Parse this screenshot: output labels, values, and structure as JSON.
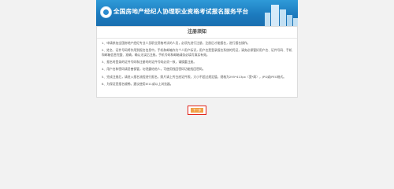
{
  "header": {
    "title": "全国房地产经纪人协理职业资格考试报名服务平台"
  },
  "notice": {
    "heading": "注册须知",
    "rules": [
      "1、申请参加全国房地产经纪专业人员职业资格考试的人员，必须先进行注册，注册后才能报名，进行报名操作。",
      "2、姓名、证件号码将作用到报名信息中。手机和邮箱作为个人用户标识，用户名是登录报名系统的凭证，请务必保管好用户名、证件号码、手机和邮箱信息完整、准确，确认无误后注册。手机号码和邮箱请务必填写真实有效。",
      "3、报名时登录的证件号码和注册时的证件号码必须一致，请慎重注册。",
      "4、用户名和密码请妥善保管，勿泄露给他人，可使用找回密码功能找回密码。",
      "5、完成注册后，请进入报名流程进行报名，照片请上传白底证件照，大小不超过规定值，规格为295*413px（宽*高），JPG或JPEG格式。",
      "6、为保证您报名顺畅，建议使用IE11或以上浏览器。"
    ]
  },
  "actions": {
    "next_label": "下一步"
  },
  "colors": {
    "banner": "#1b79bd",
    "button_border": "#e2231a",
    "button_fill": "#f0a045"
  }
}
